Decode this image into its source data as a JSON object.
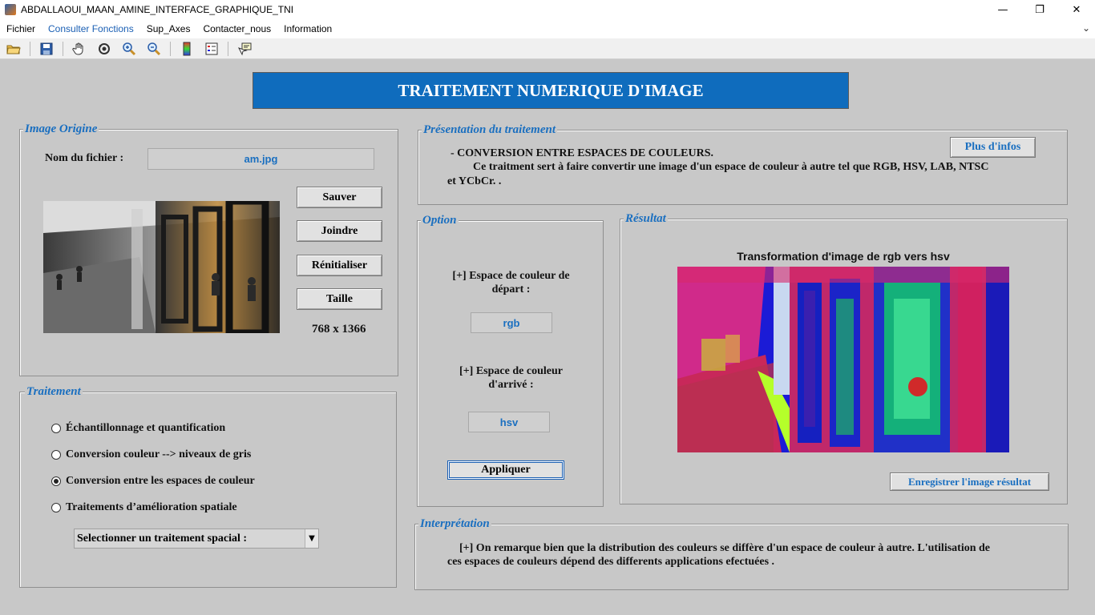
{
  "window": {
    "title": "ABDALLAOUI_MAAN_AMINE_INTERFACE_GRAPHIQUE_TNI",
    "minimize": "—",
    "maximize": "❐",
    "close": "✕"
  },
  "menu": {
    "items": [
      "Fichier",
      "Consulter Fonctions",
      "Sup_Axes",
      "Contacter_nous",
      "Information"
    ],
    "arrow": "⌄"
  },
  "toolbar": {
    "icons": [
      "open-folder-icon",
      "save-icon",
      "pan-hand-icon",
      "rotate-3d-icon",
      "zoom-in-icon",
      "zoom-out-icon",
      "colorbar-icon",
      "legend-icon",
      "data-cursor-icon"
    ]
  },
  "banner": {
    "title": "TRAITEMENT NUMERIQUE D'IMAGE"
  },
  "image_origine": {
    "legend": "Image Origine",
    "filename_label": "Nom du fichier :",
    "filename_value": "am.jpg",
    "buttons": {
      "save": "Sauver",
      "attach": "Joindre",
      "reset": "Rénitialiser",
      "size": "Taille"
    },
    "size_value": "768 x 1366"
  },
  "traitement": {
    "legend": "Traitement",
    "options": [
      {
        "label": "Échantillonnage et quantification",
        "checked": false
      },
      {
        "label": "Conversion couleur --> niveaux de gris",
        "checked": false
      },
      {
        "label": "Conversion entre les espaces de couleur",
        "checked": true
      },
      {
        "label": "Traitements d’amélioration spatiale",
        "checked": false
      }
    ],
    "select_value": "Selectionner un traitement spacial :"
  },
  "presentation": {
    "legend": "Présentation du traitement",
    "line1": "- CONVERSION ENTRE ESPACES DE COULEURS.",
    "line2": "Ce traitment sert à faire convertir une image d'un espace de couleur à autre tel que RGB, HSV, LAB, NTSC",
    "line3": "et YCbCr. .",
    "more_button": "Plus d'infos"
  },
  "option": {
    "legend": "Option",
    "from_label_1": "[+] Espace de couleur de",
    "from_label_2": "départ :",
    "from_value": "rgb",
    "to_label_1": "[+] Espace de couleur",
    "to_label_2": "d'arrivé :",
    "to_value": "hsv",
    "apply_button": "Appliquer"
  },
  "resultat": {
    "legend": "Résultat",
    "plot_title": "Transformation d'image de rgb vers hsv",
    "save_button": "Enregistrer l'image résultat"
  },
  "interpretation": {
    "legend": "Interprétation",
    "line1": "[+] On remarque bien que la distribution des couleurs se diffère d'un espace de couleur à autre. L'utilisation de",
    "line2": "ces espaces de couleurs dépend des differents applications efectuées ."
  },
  "colors": {
    "accent_blue": "#1a6fc0",
    "banner_blue": "#0f6cbd",
    "background": "#c8c8c8"
  }
}
